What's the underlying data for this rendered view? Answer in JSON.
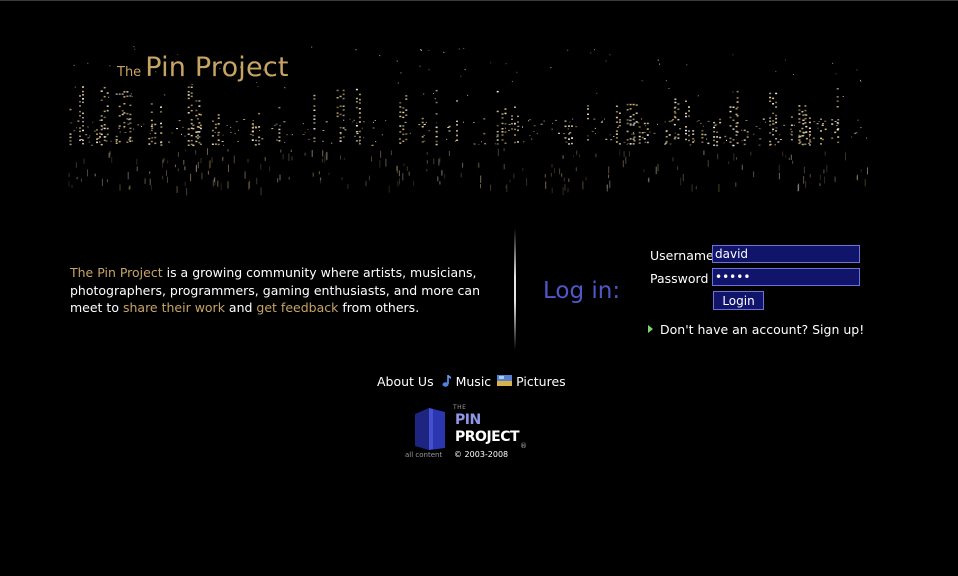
{
  "banner": {
    "logo_the": "The",
    "logo_main": "Pin Project"
  },
  "intro": {
    "site_name": "The Pin Project",
    "text_1": " is a growing community where artists, musicians, photographers, programmers, gaming enthusiasts, and more can meet to ",
    "link_share": "share their work",
    "text_2": " and ",
    "link_feedback": "get feedback",
    "text_3": " from others."
  },
  "login": {
    "heading": "Log in:",
    "username_label": "Username",
    "username_value": "david",
    "password_label": "Password",
    "password_value": "•••••",
    "button_label": "Login",
    "signup_text": "Don't have an account? Sign up!"
  },
  "nav": {
    "about": "About Us",
    "music": "Music",
    "pictures": "Pictures"
  },
  "footer": {
    "logo_the": "THE",
    "logo_pin": "PIN",
    "logo_project": "PROJECT",
    "registered": "®",
    "all_content": "all content",
    "copyright": "© 2003-2008"
  },
  "colors": {
    "background": "#000000",
    "accent": "#c8a464",
    "heading_blue": "#4f57c9",
    "input_bg": "#10146a",
    "arrow_green": "#7cd86a"
  }
}
